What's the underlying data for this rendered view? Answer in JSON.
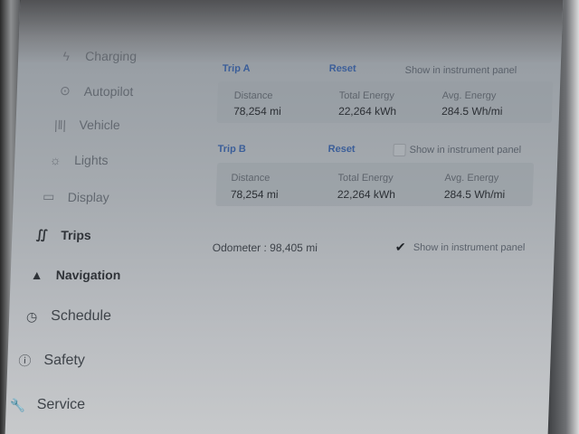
{
  "sidebar": {
    "items": [
      {
        "label": "Charging",
        "icon": "charging-icon",
        "glyph": "ϟ"
      },
      {
        "label": "Autopilot",
        "icon": "steering-wheel-icon",
        "glyph": "⊙"
      },
      {
        "label": "Vehicle",
        "icon": "vehicle-icon",
        "glyph": "|‖|"
      },
      {
        "label": "Lights",
        "icon": "sun-icon",
        "glyph": "☼"
      },
      {
        "label": "Display",
        "icon": "display-icon",
        "glyph": "▭"
      },
      {
        "label": "Trips",
        "icon": "trips-icon",
        "glyph": "∬"
      },
      {
        "label": "Navigation",
        "icon": "navigation-arrow-icon",
        "glyph": "▲"
      },
      {
        "label": "Schedule",
        "icon": "clock-icon",
        "glyph": "◷"
      },
      {
        "label": "Safety",
        "icon": "safety-icon",
        "glyph": "ⓘ"
      },
      {
        "label": "Service",
        "icon": "wrench-icon",
        "glyph": "🔧"
      }
    ]
  },
  "tripA": {
    "title": "Trip A",
    "reset": "Reset",
    "show_label": "Show in instrument panel",
    "stats": [
      {
        "label": "Distance",
        "value": "78,254 mi"
      },
      {
        "label": "Total Energy",
        "value": "22,264 kWh"
      },
      {
        "label": "Avg. Energy",
        "value": "284.5 Wh/mi"
      }
    ]
  },
  "tripB": {
    "title": "Trip B",
    "reset": "Reset",
    "show_label": "Show in instrument panel",
    "stats": [
      {
        "label": "Distance",
        "value": "78,254 mi"
      },
      {
        "label": "Total Energy",
        "value": "22,264 kWh"
      },
      {
        "label": "Avg. Energy",
        "value": "284.5 Wh/mi"
      }
    ]
  },
  "odometer": {
    "text": "Odometer : 98,405 mi",
    "show_label": "Show in instrument panel",
    "checked": true
  }
}
